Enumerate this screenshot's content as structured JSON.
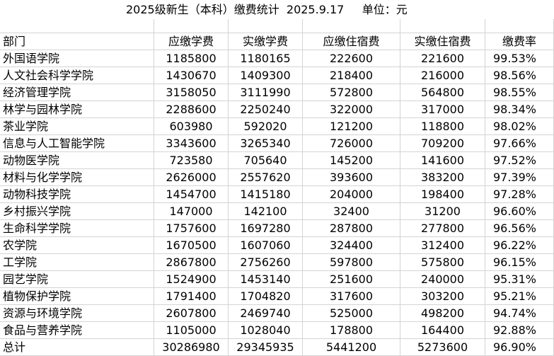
{
  "title": "2025级新生（本科）缴费统计  2025.9.17     单位：元",
  "headers": [
    "部门",
    "应缴学费",
    "实缴学费",
    "应缴住宿费",
    "实缴住宿费",
    "缴费率"
  ],
  "rows": [
    [
      "外国语学院",
      "1185800",
      "1180165",
      "222600",
      "221600",
      "99.53%"
    ],
    [
      "人文社会科学学院",
      "1430670",
      "1409300",
      "218400",
      "216000",
      "98.56%"
    ],
    [
      "经济管理学院",
      "3158050",
      "3111990",
      "572800",
      "564800",
      "98.55%"
    ],
    [
      "林学与园林学院",
      "2288600",
      "2250240",
      "322000",
      "317000",
      "98.34%"
    ],
    [
      "茶业学院",
      "603980",
      "592020",
      "121200",
      "118800",
      "98.02%"
    ],
    [
      "信息与人工智能学院",
      "3343600",
      "3265340",
      "726000",
      "709200",
      "97.66%"
    ],
    [
      "动物医学院",
      "723580",
      "705640",
      "145200",
      "141600",
      "97.52%"
    ],
    [
      "材料与化学学院",
      "2626000",
      "2557620",
      "393600",
      "383200",
      "97.39%"
    ],
    [
      "动物科技学院",
      "1454700",
      "1415180",
      "204000",
      "198400",
      "97.28%"
    ],
    [
      "乡村振兴学院",
      "147000",
      "142100",
      "32400",
      "31200",
      "96.60%"
    ],
    [
      "生命科学学院",
      "1757600",
      "1697280",
      "287800",
      "277800",
      "96.56%"
    ],
    [
      "农学院",
      "1670500",
      "1607060",
      "324400",
      "312400",
      "96.22%"
    ],
    [
      "工学院",
      "2867800",
      "2756260",
      "597800",
      "575800",
      "96.15%"
    ],
    [
      "园艺学院",
      "1524900",
      "1453140",
      "251600",
      "240000",
      "95.31%"
    ],
    [
      "植物保护学院",
      "1791400",
      "1704820",
      "317600",
      "303200",
      "95.21%"
    ],
    [
      "资源与环境学院",
      "2607800",
      "2469740",
      "525000",
      "498200",
      "94.74%"
    ],
    [
      "食品与营养学院",
      "1105000",
      "1028040",
      "178800",
      "164400",
      "92.88%"
    ]
  ],
  "total": [
    "总计",
    "30286980",
    "29345935",
    "5441200",
    "5273600",
    "96.90%"
  ]
}
